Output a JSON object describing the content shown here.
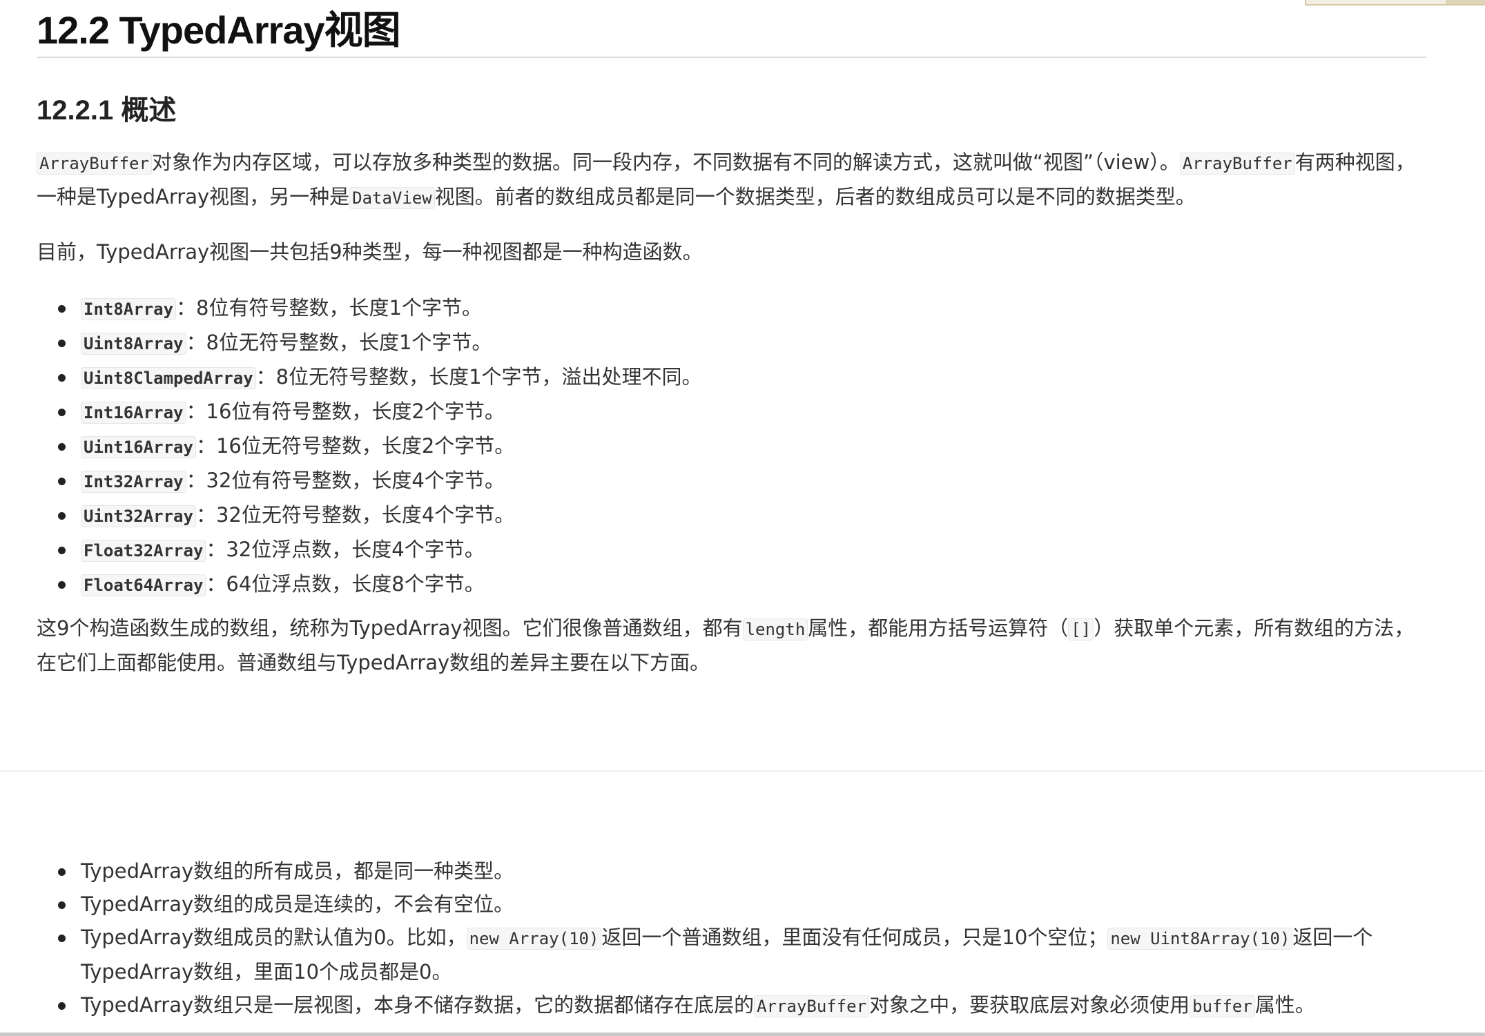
{
  "heading": "12.2 TypedArray视图",
  "subheading": "12.2.1 概述",
  "intro": {
    "code1": "ArrayBuffer",
    "t1": "对象作为内存区域，可以存放多种类型的数据。同一段内存，不同数据有不同的解读方式，这就叫做“视图”（view）。",
    "code2": "ArrayBuffer",
    "t2": "有两种视图，一种是TypedArray视图，另一种是",
    "code3": "DataView",
    "t3": "视图。前者的数组成员都是同一个数据类型，后者的数组成员可以是不同的数据类型。"
  },
  "count_paragraph": "目前，TypedArray视图一共包括9种类型，每一种视图都是一种构造函数。",
  "types": [
    {
      "name": "Int8Array",
      "desc": "：8位有符号整数，长度1个字节。"
    },
    {
      "name": "Uint8Array",
      "desc": "：8位无符号整数，长度1个字节。"
    },
    {
      "name": "Uint8ClampedArray",
      "desc": "：8位无符号整数，长度1个字节，溢出处理不同。"
    },
    {
      "name": "Int16Array",
      "desc": "：16位有符号整数，长度2个字节。"
    },
    {
      "name": "Uint16Array",
      "desc": "：16位无符号整数，长度2个字节。"
    },
    {
      "name": "Int32Array",
      "desc": "：32位有符号整数，长度4个字节。"
    },
    {
      "name": "Uint32Array",
      "desc": "：32位无符号整数，长度4个字节。"
    },
    {
      "name": "Float32Array",
      "desc": "：32位浮点数，长度4个字节。"
    },
    {
      "name": "Float64Array",
      "desc": "：64位浮点数，长度8个字节。"
    }
  ],
  "summary": {
    "t1": "这9个构造函数生成的数组，统称为TypedArray视图。它们很像普通数组，都有",
    "code1": "length",
    "t2": "属性，都能用方括号运算符（",
    "code2": "[]",
    "t3": "）获取单个元素，所有数组的方法，在它们上面都能使用。普通数组与TypedArray数组的差异主要在以下方面。"
  },
  "differences": {
    "d1": "TypedArray数组的所有成员，都是同一种类型。",
    "d2": "TypedArray数组的成员是连续的，不会有空位。",
    "d3_t1": "TypedArray数组成员的默认值为0。比如，",
    "d3_code1": "new Array(10)",
    "d3_t2": "返回一个普通数组，里面没有任何成员，只是10个空位；",
    "d3_code2": "new Uint8Array(10)",
    "d3_t3": "返回一个TypedArray数组，里面10个成员都是0。",
    "d4_t1": "TypedArray数组只是一层视图，本身不储存数据，它的数据都储存在底层的",
    "d4_code1": "ArrayBuffer",
    "d4_t2": "对象之中，要获取底层对象必须使用",
    "d4_code2": "buffer",
    "d4_t3": "属性。"
  }
}
